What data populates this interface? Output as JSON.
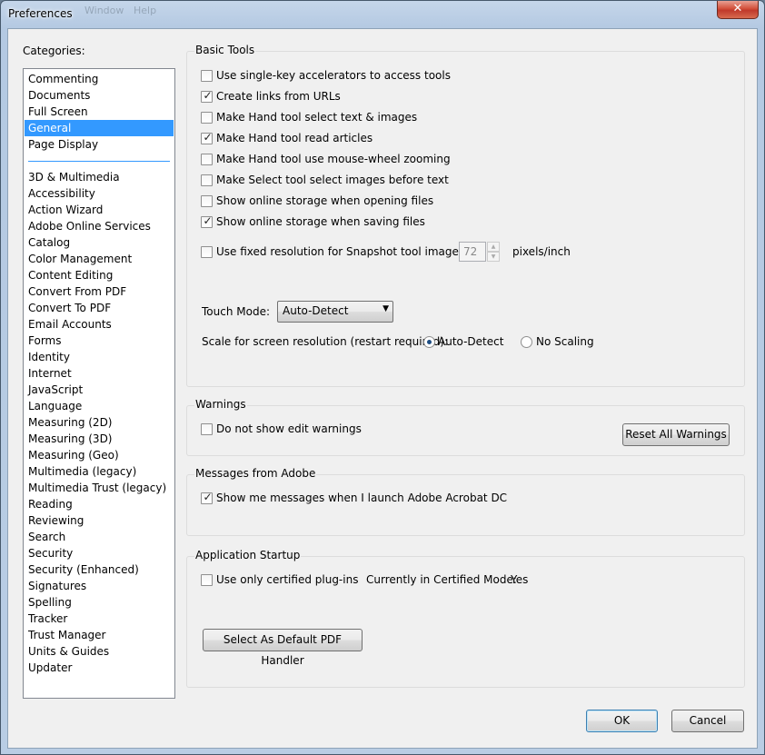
{
  "window": {
    "title": "Preferences",
    "close_glyph": "✕",
    "ghost_menu": [
      "Window",
      "Help"
    ]
  },
  "categories": {
    "heading": "Categories:",
    "top_items": [
      "Commenting",
      "Documents",
      "Full Screen",
      "General",
      "Page Display"
    ],
    "selected": "General",
    "items": [
      "3D & Multimedia",
      "Accessibility",
      "Action Wizard",
      "Adobe Online Services",
      "Catalog",
      "Color Management",
      "Content Editing",
      "Convert From PDF",
      "Convert To PDF",
      "Email Accounts",
      "Forms",
      "Identity",
      "Internet",
      "JavaScript",
      "Language",
      "Measuring (2D)",
      "Measuring (3D)",
      "Measuring (Geo)",
      "Multimedia (legacy)",
      "Multimedia Trust (legacy)",
      "Reading",
      "Reviewing",
      "Search",
      "Security",
      "Security (Enhanced)",
      "Signatures",
      "Spelling",
      "Tracker",
      "Trust Manager",
      "Units & Guides",
      "Updater"
    ]
  },
  "basic_tools": {
    "title": "Basic Tools",
    "options": [
      {
        "label": "Use single-key accelerators to access tools",
        "checked": false
      },
      {
        "label": "Create links from URLs",
        "checked": true
      },
      {
        "label": "Make Hand tool select text & images",
        "checked": false
      },
      {
        "label": "Make Hand tool read articles",
        "checked": true
      },
      {
        "label": "Make Hand tool use mouse-wheel zooming",
        "checked": false
      },
      {
        "label": "Make Select tool select images before text",
        "checked": false
      },
      {
        "label": "Show online storage when opening files",
        "checked": false
      },
      {
        "label": "Show online storage when saving files",
        "checked": true
      }
    ],
    "snapshot": {
      "label": "Use fixed resolution for Snapshot tool images:",
      "checked": false,
      "value": "72",
      "unit": "pixels/inch"
    },
    "touch_mode": {
      "label": "Touch Mode:",
      "value": "Auto-Detect"
    },
    "scale": {
      "label": "Scale for screen resolution (restart required):",
      "options": [
        {
          "label": "Auto-Detect",
          "selected": true
        },
        {
          "label": "No Scaling",
          "selected": false
        }
      ]
    }
  },
  "warnings": {
    "title": "Warnings",
    "option": {
      "label": "Do not show edit warnings",
      "checked": false
    },
    "reset_button": "Reset All Warnings"
  },
  "messages": {
    "title": "Messages from Adobe",
    "option": {
      "label": "Show me messages when I launch Adobe Acrobat DC",
      "checked": true
    }
  },
  "startup": {
    "title": "Application Startup",
    "option": {
      "label": "Use only certified plug-ins",
      "checked": false
    },
    "certified_mode_label": "Currently in Certified Mode:",
    "certified_mode_value": "Yes",
    "default_handler_button": "Select As Default PDF Handler"
  },
  "footer": {
    "ok": "OK",
    "cancel": "Cancel"
  },
  "glyphs": {
    "check": "✓",
    "dropdown_arrow": "▼",
    "spin_up": "▲",
    "spin_down": "▼"
  }
}
